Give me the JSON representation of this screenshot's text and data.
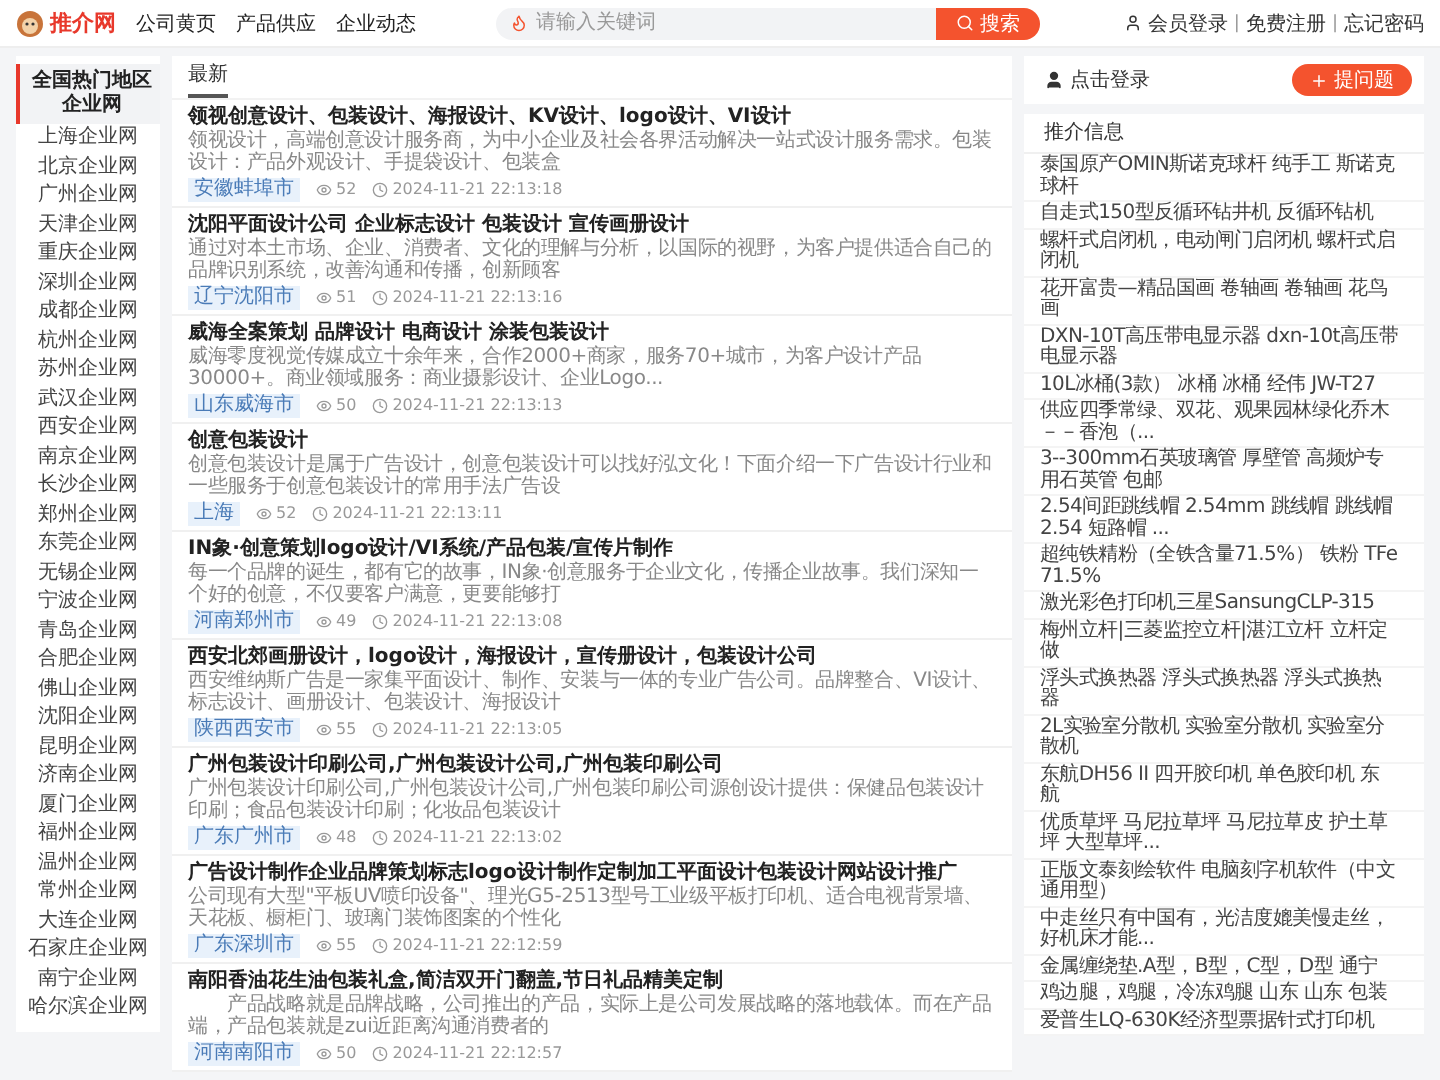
{
  "header": {
    "logo_text": "推介网",
    "nav": [
      "公司黄页",
      "产品供应",
      "企业动态"
    ],
    "search": {
      "placeholder": "请输入关键词",
      "button": "搜索"
    },
    "account_links": [
      "会员登录",
      "免费注册",
      "忘记密码"
    ],
    "separator": "|"
  },
  "sidebar": {
    "title": "全国热门地区企业网",
    "items": [
      "上海企业网",
      "北京企业网",
      "广州企业网",
      "天津企业网",
      "重庆企业网",
      "深圳企业网",
      "成都企业网",
      "杭州企业网",
      "苏州企业网",
      "武汉企业网",
      "西安企业网",
      "南京企业网",
      "长沙企业网",
      "郑州企业网",
      "东莞企业网",
      "无锡企业网",
      "宁波企业网",
      "青岛企业网",
      "合肥企业网",
      "佛山企业网",
      "沈阳企业网",
      "昆明企业网",
      "济南企业网",
      "厦门企业网",
      "福州企业网",
      "温州企业网",
      "常州企业网",
      "大连企业网",
      "石家庄企业网",
      "南宁企业网",
      "哈尔滨企业网"
    ]
  },
  "main": {
    "tabs": [
      {
        "label": "最新",
        "selected": true
      }
    ],
    "articles": [
      {
        "title": "领视创意设计、包装设计、海报设计、KV设计、logo设计、VI设计",
        "summary": "领视设计，高端创意设计服务商，为中小企业及社会各界活动解决一站式设计服务需求。包装设计：产品外观设计、手提袋设计、包装盒",
        "location": "安徽蚌埠市",
        "views": "52",
        "time": "2024-11-21 22:13:18"
      },
      {
        "title": "沈阳平面设计公司 企业标志设计 包装设计 宣传画册设计",
        "summary": "通过对本土市场、企业、消费者、文化的理解与分析，以国际的视野，为客户提供适合自己的品牌识别系统，改善沟通和传播，创新顾客",
        "location": "辽宁沈阳市",
        "views": "51",
        "time": "2024-11-21 22:13:16"
      },
      {
        "title": "威海全案策划 品牌设计 电商设计 涂装包装设计",
        "summary": "威海零度视觉传媒成立十余年来，合作2000+商家，服务70+城市，为客户设计产品30000+。商业领域服务：商业摄影设计、企业Logo...",
        "location": "山东威海市",
        "views": "50",
        "time": "2024-11-21 22:13:13"
      },
      {
        "title": "创意包装设计",
        "summary": "创意包装设计是属于广告设计，创意包装设计可以找好泓文化！下面介绍一下广告设计行业和一些服务于创意包装设计的常用手法广告设",
        "location": "上海",
        "views": "52",
        "time": "2024-11-21 22:13:11"
      },
      {
        "title": "IN象·创意策划logo设计/VI系统/产品包装/宣传片制作",
        "summary": "每一个品牌的诞生，都有它的故事，IN象·创意服务于企业文化，传播企业故事。我们深知一个好的创意，不仅要客户满意，更要能够打",
        "location": "河南郑州市",
        "views": "49",
        "time": "2024-11-21 22:13:08"
      },
      {
        "title": "西安北郊画册设计，logo设计，海报设计，宣传册设计，包装设计公司",
        "summary": "西安维纳斯广告是一家集平面设计、制作、安装与一体的专业广告公司。品牌整合、VI设计、标志设计、画册设计、包装设计、海报设计",
        "location": "陕西西安市",
        "views": "55",
        "time": "2024-11-21 22:13:05"
      },
      {
        "title": "广州包装设计印刷公司,广州包装设计公司,广州包装印刷公司",
        "summary": "广州包装设计印刷公司,广州包装设计公司,广州包装印刷公司源创设计提供：保健品包装设计印刷；食品包装设计印刷；化妆品包装设计",
        "location": "广东广州市",
        "views": "48",
        "time": "2024-11-21 22:13:02"
      },
      {
        "title": "广告设计制作企业品牌策划标志logo设计制作定制加工平面设计包装设计网站设计推广",
        "summary": "公司现有大型\"平板UV喷印设备\"、理光G5-2513型号工业级平板打印机、适合电视背景墙、天花板、橱柜门、玻璃门装饰图案的个性化",
        "location": "广东深圳市",
        "views": "55",
        "time": "2024-11-21 22:12:59"
      },
      {
        "title": "南阳香油花生油包装礼盒,简洁双开门翻盖,节日礼品精美定制",
        "summary": "　　产品战略就是品牌战略，公司推出的产品，实际上是公司发展战略的落地载体。而在产品端，产品包装就是zui近距离沟通消费者的",
        "location": "河南南阳市",
        "views": "50",
        "time": "2024-11-21 22:12:57"
      }
    ]
  },
  "right": {
    "login": {
      "label": "点击登录",
      "button": "提问题"
    },
    "recommend": {
      "title": "推介信息",
      "items": [
        "泰国原产OMIN斯诺克球杆 纯手工 斯诺克球杆",
        "自走式150型反循环钻井机 反循环钻机",
        "螺杆式启闭机，电动闸门启闭机 螺杆式启闭机",
        "花开富贵—精品国画 卷轴画 卷轴画 花鸟画",
        "DXN-10T高压带电显示器 dxn-10t高压带电显示器",
        "10L冰桶(3款） 冰桶 冰桶 经伟 JW-T27",
        "供应四季常绿、双花、观果园林绿化乔木－－香泡（...",
        "3--300mm石英玻璃管 厚壁管 高频炉专用石英管 包邮",
        "2.54间距跳线帽 2.54mm 跳线帽 跳线帽2.54 短路帽 ...",
        "超纯铁精粉（全铁含量71.5%） 铁粉 TFe71.5%",
        "激光彩色打印机三星SansungCLP-315",
        "梅州立杆|三菱监控立杆|湛江立杆 立杆定做",
        "浮头式换热器 浮头式换热器 浮头式换热器",
        "2L实验室分散机 实验室分散机 实验室分散机",
        "东航DH56 II 四开胶印机 单色胶印机 东航",
        "优质草坪 马尼拉草坪 马尼拉草皮 护土草坪 大型草坪...",
        "正版文泰刻绘软件 电脑刻字机软件（中文通用型）",
        "中走丝只有中国有，光洁度媲美慢走丝，好机床才能...",
        "金属缠绕垫.A型，B型，C型，D型 通宁",
        "鸡边腿，鸡腿，冷冻鸡腿 山东 山东 包装",
        "爱普生LQ-630K经济型票据针式打印机"
      ]
    }
  }
}
